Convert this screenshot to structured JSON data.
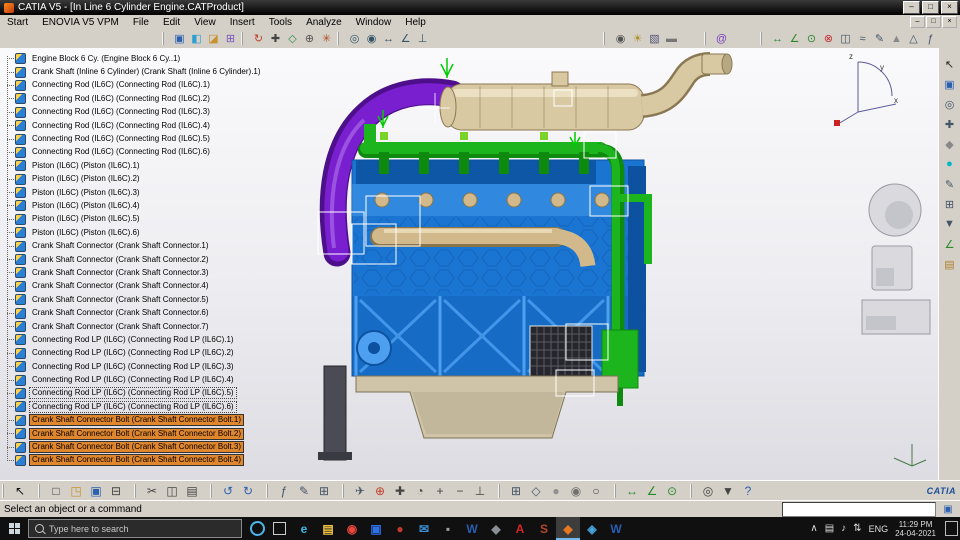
{
  "window": {
    "title": "CATIA V5 - [In Line 6 Cylinder Engine.CATProduct]",
    "controls": [
      {
        "name": "minimize-button",
        "glyph": "–"
      },
      {
        "name": "maximize-button",
        "glyph": "□"
      },
      {
        "name": "close-button",
        "glyph": "×"
      }
    ],
    "doc_controls": [
      {
        "name": "doc-minimize-button",
        "glyph": "–"
      },
      {
        "name": "doc-restore-button",
        "glyph": "□"
      },
      {
        "name": "doc-close-button",
        "glyph": "×"
      }
    ]
  },
  "menu": {
    "items": [
      {
        "label": "Start"
      },
      {
        "label": "ENOVIA V5 VPM"
      },
      {
        "label": "File"
      },
      {
        "label": "Edit"
      },
      {
        "label": "View"
      },
      {
        "label": "Insert"
      },
      {
        "label": "Tools"
      },
      {
        "label": "Analyze"
      },
      {
        "label": "Window"
      },
      {
        "label": "Help"
      }
    ]
  },
  "toolbar_top": {
    "groups": [
      {
        "icons": [
          {
            "name": "product-structure-icon",
            "glyph": "▣",
            "color": "#2b5fb0"
          },
          {
            "name": "component-icon",
            "glyph": "◧",
            "color": "#2b9fd0"
          },
          {
            "name": "part-icon",
            "glyph": "◪",
            "color": "#c8912b"
          },
          {
            "name": "existing-component-icon",
            "glyph": "⊞",
            "color": "#7a55c0"
          }
        ]
      },
      {
        "icons": [
          {
            "name": "update-icon",
            "glyph": "↻",
            "color": "#c04028"
          },
          {
            "name": "manipulation-icon",
            "glyph": "✚",
            "color": "#444444"
          },
          {
            "name": "smart-move-icon",
            "glyph": "◇",
            "color": "#2b8f4a"
          },
          {
            "name": "snap-icon",
            "glyph": "⊕",
            "color": "#555555"
          },
          {
            "name": "explode-icon",
            "glyph": "✳",
            "color": "#b05020"
          }
        ]
      },
      {
        "icons": [
          {
            "name": "coincidence-constraint-icon",
            "glyph": "◎",
            "color": "#335566"
          },
          {
            "name": "contact-constraint-icon",
            "glyph": "◉",
            "color": "#335566"
          },
          {
            "name": "offset-constraint-icon",
            "glyph": "↔",
            "color": "#335566"
          },
          {
            "name": "angle-constraint-icon",
            "glyph": "∠",
            "color": "#335566"
          },
          {
            "name": "fix-constraint-icon",
            "glyph": "⊥",
            "color": "#335566"
          }
        ]
      },
      {
        "icons": [
          {
            "name": "camera-icon",
            "glyph": "◉",
            "color": "#555555"
          },
          {
            "name": "light-icon",
            "glyph": "☀",
            "color": "#b09020"
          },
          {
            "name": "depth-effect-icon",
            "glyph": "▧",
            "color": "#555577"
          },
          {
            "name": "ground-icon",
            "glyph": "▬",
            "color": "#777777"
          }
        ]
      },
      {
        "icons": [
          {
            "name": "enovia-connection-icon",
            "glyph": "@",
            "color": "#7a3fbf"
          }
        ]
      },
      {
        "icons": [
          {
            "name": "measure-between-icon",
            "glyph": "↔",
            "color": "#2a8a2a"
          },
          {
            "name": "measure-item-icon",
            "glyph": "∠",
            "color": "#2a8a2a"
          },
          {
            "name": "mass-properties-icon",
            "glyph": "⊙",
            "color": "#2a8a2a"
          },
          {
            "name": "clash-analysis-icon",
            "glyph": "⊗",
            "color": "#c03030"
          },
          {
            "name": "sectioning-icon",
            "glyph": "◫",
            "color": "#445566"
          },
          {
            "name": "distance-analysis-icon",
            "glyph": "≈",
            "color": "#445566"
          },
          {
            "name": "annotation-icon",
            "glyph": "✎",
            "color": "#445566"
          },
          {
            "name": "weld-feature-icon",
            "glyph": "▲",
            "color": "#888888"
          },
          {
            "name": "publication-icon",
            "glyph": "△",
            "color": "#445566"
          },
          {
            "name": "knowledge-icon",
            "glyph": "ƒ",
            "color": "#445566"
          }
        ]
      }
    ]
  },
  "tree": {
    "items": [
      {
        "label": "Engine Block 6 Cy. (Engine Block 6 Cy..1)"
      },
      {
        "label": "Crank Shaft (Inline 6 Cylinder) (Crank Shaft (Inline 6 Cylinder).1)"
      },
      {
        "label": "Connecting Rod (IL6C) (Connecting Rod (IL6C).1)"
      },
      {
        "label": "Connecting Rod (IL6C) (Connecting Rod (IL6C).2)"
      },
      {
        "label": "Connecting Rod (IL6C) (Connecting Rod (IL6C).3)"
      },
      {
        "label": "Connecting Rod (IL6C) (Connecting Rod (IL6C).4)"
      },
      {
        "label": "Connecting Rod (IL6C) (Connecting Rod (IL6C).5)"
      },
      {
        "label": "Connecting Rod (IL6C) (Connecting Rod (IL6C).6)"
      },
      {
        "label": "Piston (IL6C) (Piston (IL6C).1)"
      },
      {
        "label": "Piston (IL6C) (Piston (IL6C).2)"
      },
      {
        "label": "Piston (IL6C) (Piston (IL6C).3)"
      },
      {
        "label": "Piston (IL6C) (Piston (IL6C).4)"
      },
      {
        "label": "Piston (IL6C) (Piston (IL6C).5)"
      },
      {
        "label": "Piston (IL6C) (Piston (IL6C).6)"
      },
      {
        "label": "Crank Shaft Connector (Crank Shaft Connector.1)"
      },
      {
        "label": "Crank Shaft Connector (Crank Shaft Connector.2)"
      },
      {
        "label": "Crank Shaft Connector (Crank Shaft Connector.3)"
      },
      {
        "label": "Crank Shaft Connector (Crank Shaft Connector.4)"
      },
      {
        "label": "Crank Shaft Connector (Crank Shaft Connector.5)"
      },
      {
        "label": "Crank Shaft Connector (Crank Shaft Connector.6)"
      },
      {
        "label": "Crank Shaft Connector (Crank Shaft Connector.7)"
      },
      {
        "label": "Connecting Rod LP (IL6C) (Connecting Rod LP (IL6C).1)"
      },
      {
        "label": "Connecting Rod LP (IL6C) (Connecting Rod LP (IL6C).2)"
      },
      {
        "label": "Connecting Rod LP (IL6C) (Connecting Rod LP (IL6C).3)"
      },
      {
        "label": "Connecting Rod LP (IL6C) (Connecting Rod LP (IL6C).4)"
      },
      {
        "label": "Connecting Rod LP (IL6C) (Connecting Rod LP (IL6C).5)",
        "framed": true
      },
      {
        "label": "Connecting Rod LP (IL6C) (Connecting Rod LP (IL6C).6)",
        "framed": true
      },
      {
        "label": "Crank Shaft Connector Bolt (Crank Shaft Connector Bolt.1)",
        "selected": true
      },
      {
        "label": "Crank Shaft Connector Bolt (Crank Shaft Connector Bolt.2)",
        "selected": true
      },
      {
        "label": "Crank Shaft Connector Bolt (Crank Shaft Connector Bolt.3)",
        "selected": true
      },
      {
        "label": "Crank Shaft Connector Bolt (Crank Shaft Connector Bolt.4)",
        "selected": true
      }
    ]
  },
  "viewport": {
    "model_name": "In Line 6 Cylinder Engine",
    "compass_labels": [
      "x",
      "y",
      "z"
    ],
    "colors": {
      "block": "#1a75d2",
      "block_dark": "#0d52a0",
      "block_light": "#4da0f0",
      "manifold": "#1db51d",
      "manifold_dark": "#0e8a0e",
      "intake": "#7a1fd0",
      "intake_dark": "#4d0f8a",
      "muffler": "#d9c9a2",
      "muffler_dark": "#8a7852",
      "pipe_tan": "#d2b98c",
      "pan": "#cfc4a8",
      "pan_dark": "#7a7258",
      "grille": "#26262c",
      "wire": "#ffffff",
      "axis_green": "#00cc00"
    }
  },
  "toolbar_right": {
    "icons": [
      {
        "name": "select-tool-icon",
        "glyph": "↖",
        "color": "#222222"
      },
      {
        "name": "product-node-icon",
        "glyph": "▣",
        "color": "#2b5fb0"
      },
      {
        "name": "constraints-toolbar-icon",
        "glyph": "◎",
        "color": "#445566"
      },
      {
        "name": "move-toolbar-icon",
        "glyph": "✚",
        "color": "#445566"
      },
      {
        "name": "assembly-features-icon",
        "glyph": "◆",
        "color": "#888888"
      },
      {
        "name": "space-analysis-icon",
        "glyph": "●",
        "color": "#00b8c8"
      },
      {
        "name": "annotations-toolbar-icon",
        "glyph": "✎",
        "color": "#445566"
      },
      {
        "name": "scenes-icon",
        "glyph": "⊞",
        "color": "#445566"
      },
      {
        "name": "filters-icon",
        "glyph": "▼",
        "color": "#445566"
      },
      {
        "name": "measure-toolbar-icon",
        "glyph": "∠",
        "color": "#2a8a2a"
      },
      {
        "name": "catalog-browser-icon",
        "glyph": "▤",
        "color": "#b08030"
      }
    ]
  },
  "toolbar_bottom": {
    "logo_text": "CATIA",
    "groups": [
      {
        "icons": [
          {
            "name": "select-cursor-icon",
            "glyph": "↖",
            "color": "#111111"
          }
        ]
      },
      {
        "icons": [
          {
            "name": "new-file-icon",
            "glyph": "□",
            "color": "#444444"
          },
          {
            "name": "open-file-icon",
            "glyph": "◳",
            "color": "#c8912b"
          },
          {
            "name": "save-icon",
            "glyph": "▣",
            "color": "#2b5fb0"
          },
          {
            "name": "print-icon",
            "glyph": "⊟",
            "color": "#444444"
          }
        ]
      },
      {
        "icons": [
          {
            "name": "cut-icon",
            "glyph": "✂",
            "color": "#444444"
          },
          {
            "name": "copy-icon",
            "glyph": "◫",
            "color": "#444444"
          },
          {
            "name": "paste-icon",
            "glyph": "▤",
            "color": "#444444"
          }
        ]
      },
      {
        "icons": [
          {
            "name": "undo-icon",
            "glyph": "↺",
            "color": "#2b5fb0"
          },
          {
            "name": "redo-icon",
            "glyph": "↻",
            "color": "#2b5fb0"
          }
        ]
      },
      {
        "icons": [
          {
            "name": "knowledge-fx-icon",
            "glyph": "ƒ",
            "color": "#445566"
          },
          {
            "name": "pen-icon",
            "glyph": "✎",
            "color": "#445566"
          },
          {
            "name": "design-table-icon",
            "glyph": "⊞",
            "color": "#445566"
          }
        ]
      },
      {
        "icons": [
          {
            "name": "fly-mode-icon",
            "glyph": "✈",
            "color": "#445566"
          },
          {
            "name": "fit-all-in-icon",
            "glyph": "⊕",
            "color": "#c04028"
          },
          {
            "name": "pan-icon",
            "glyph": "✚",
            "color": "#444444"
          },
          {
            "name": "rotate-icon",
            "glyph": "◔",
            "color": "#444444"
          },
          {
            "name": "zoom-in-icon",
            "glyph": "+",
            "color": "#444444"
          },
          {
            "name": "zoom-out-icon",
            "glyph": "−",
            "color": "#444444"
          },
          {
            "name": "normal-view-icon",
            "glyph": "⊥",
            "color": "#444444"
          }
        ]
      },
      {
        "icons": [
          {
            "name": "multi-view-icon",
            "glyph": "⊞",
            "color": "#445566"
          },
          {
            "name": "iso-view-icon",
            "glyph": "◇",
            "color": "#445566"
          },
          {
            "name": "shaded-view-icon",
            "glyph": "●",
            "color": "#909090"
          },
          {
            "name": "shaded-edges-view-icon",
            "glyph": "◉",
            "color": "#707070"
          },
          {
            "name": "wireframe-view-icon",
            "glyph": "○",
            "color": "#444444"
          }
        ]
      },
      {
        "icons": [
          {
            "name": "measure-between-icon",
            "glyph": "↔",
            "color": "#2a8a2a"
          },
          {
            "name": "measure-item-icon",
            "glyph": "∠",
            "color": "#2a8a2a"
          },
          {
            "name": "mass-properties-icon",
            "glyph": "⊙",
            "color": "#2a8a2a"
          }
        ]
      },
      {
        "icons": [
          {
            "name": "magnifier-icon",
            "glyph": "◎",
            "color": "#444444"
          },
          {
            "name": "catalogs-icon",
            "glyph": "▼",
            "color": "#444444"
          },
          {
            "name": "whats-this-icon",
            "glyph": "?",
            "color": "#2b5fb0"
          }
        ]
      }
    ]
  },
  "statusbar": {
    "message": "Select an object or a command",
    "command_input_value": ""
  },
  "taskbar": {
    "search_placeholder": "Type here to search",
    "apps": [
      {
        "name": "taskbar-edge-icon",
        "glyph": "e",
        "color": "#3db7e8"
      },
      {
        "name": "taskbar-file-explorer-icon",
        "glyph": "▤",
        "color": "#f2c744"
      },
      {
        "name": "taskbar-chrome-icon",
        "glyph": "◉",
        "color": "#e8453c"
      },
      {
        "name": "taskbar-photos-icon",
        "glyph": "▣",
        "color": "#2f6fe4"
      },
      {
        "name": "taskbar-app-red-icon",
        "glyph": "●",
        "color": "#c23a2e"
      },
      {
        "name": "taskbar-mail-icon",
        "glyph": "✉",
        "color": "#3a8fd4"
      },
      {
        "name": "taskbar-terminal-icon",
        "glyph": "▪",
        "color": "#9aa0a6"
      },
      {
        "name": "taskbar-word-icon",
        "glyph": "W",
        "color": "#2b5cad"
      },
      {
        "name": "taskbar-app-gray-icon",
        "glyph": "◆",
        "color": "#8a8f98"
      },
      {
        "name": "taskbar-adobe-icon",
        "glyph": "A",
        "color": "#d02828"
      },
      {
        "name": "taskbar-sql-icon",
        "glyph": "S",
        "color": "#b5472e"
      },
      {
        "name": "taskbar-catia-icon",
        "glyph": "◆",
        "color": "#e87722",
        "active": true
      },
      {
        "name": "taskbar-app-blue-icon",
        "glyph": "◈",
        "color": "#45a6dc"
      },
      {
        "name": "taskbar-word2-icon",
        "glyph": "W",
        "color": "#2b5cad"
      }
    ],
    "tray_icons": [
      {
        "name": "tray-chevron-icon",
        "glyph": "∧"
      },
      {
        "name": "tray-pc-icon",
        "glyph": "▤"
      },
      {
        "name": "tray-volume-icon",
        "glyph": "♪"
      },
      {
        "name": "tray-network-icon",
        "glyph": "⇅"
      }
    ],
    "tray": {
      "language": "ENG",
      "time": "11:29 PM",
      "date": "24-04-2021"
    }
  }
}
